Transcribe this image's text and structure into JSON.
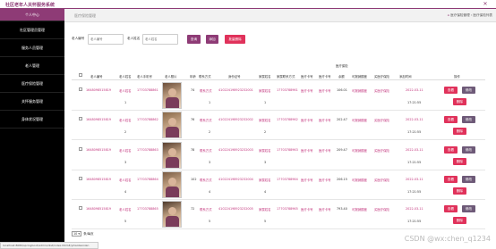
{
  "app": {
    "title": "社区老年人关怀服务系统"
  },
  "sidebar": {
    "items": [
      {
        "label": "个人中心"
      },
      {
        "label": "社区管理员管理"
      },
      {
        "label": "服务人员管理"
      },
      {
        "label": "老人管理"
      },
      {
        "label": "医疗保险管理"
      },
      {
        "label": "关怀服务管理"
      },
      {
        "label": "身体状况管理"
      }
    ]
  },
  "breadcrumb": {
    "tab": "医疗保险管理",
    "home": "⌂",
    "path": "医疗保险管理 › 医疗保险列表"
  },
  "search": {
    "field1_label": "老人编号",
    "field1_placeholder": "老人编号",
    "field2_label": "老人姓名",
    "field2_placeholder": "老人姓名",
    "query_button": "查询",
    "add_button": "添加",
    "batch_delete_button": "批量删除"
  },
  "table": {
    "group_header": "医疗保险",
    "headers": [
      "老人编号",
      "老人姓名",
      "老人手机号",
      "老人照片",
      "年龄",
      "联系方式",
      "身份证号",
      "家属姓名",
      "家属联系方式",
      "医疗卡号",
      "医疗卡号",
      "余额",
      "可报销额度",
      "买医疗保险",
      "添加时间",
      "操作"
    ],
    "rows": [
      {
        "id": "1648098515819",
        "name": "老人姓名",
        "phone": "17703788861",
        "age": "74",
        "contact": "联系方式",
        "idcard": "410224198923232001",
        "family": "家属姓名",
        "family_phone": "17703788961",
        "card": "医疗卡号",
        "card2": "医疗卡号",
        "balance": "106.01",
        "limit": "可报销额度",
        "insurance": "买医疗保险",
        "date": "2022-03-11",
        "time": "17:21:55",
        "extra_a": "1",
        "extra_b": "1",
        "extra_c": "1"
      },
      {
        "id": "1648098515819",
        "name": "老人姓名",
        "phone": "17703788862",
        "age": "76",
        "contact": "联系方式",
        "idcard": "410224198923232002",
        "family": "家属姓名",
        "family_phone": "17703788962",
        "card": "医疗卡号",
        "card2": "医疗卡号",
        "balance": "202.47",
        "limit": "可报销额度",
        "insurance": "买医疗保险",
        "date": "2022-03-11",
        "time": "17:21:55",
        "extra_a": "2",
        "extra_b": "2",
        "extra_c": "2"
      },
      {
        "id": "1648098515819",
        "name": "老人姓名",
        "phone": "17703788863",
        "age": "78",
        "contact": "联系方式",
        "idcard": "410224198923232003",
        "family": "家属姓名",
        "family_phone": "17703788963",
        "card": "医疗卡号",
        "card2": "医疗卡号",
        "balance": "209.47",
        "limit": "可报销额度",
        "insurance": "买医疗保险",
        "date": "2022-03-11",
        "time": "17:21:55",
        "extra_a": "3",
        "extra_b": "3",
        "extra_c": "3"
      },
      {
        "id": "1648098515819",
        "name": "老人姓名",
        "phone": "17703788864",
        "age": "102",
        "contact": "联系方式",
        "idcard": "410224198923232004",
        "family": "家属姓名",
        "family_phone": "17703788964",
        "card": "医疗卡号",
        "card2": "医疗卡号",
        "balance": "206.15",
        "limit": "可报销额度",
        "insurance": "买医疗保险",
        "date": "2022-03-11",
        "time": "17:21:55",
        "extra_a": "4",
        "extra_b": "4",
        "extra_c": "4"
      },
      {
        "id": "1648098515819",
        "name": "老人姓名",
        "phone": "17703788865",
        "age": "72",
        "contact": "联系方式",
        "idcard": "410224198923232005",
        "family": "家属姓名",
        "family_phone": "17703788965",
        "card": "医疗卡号",
        "card2": "医疗卡号",
        "balance": "793.40",
        "limit": "可报销额度",
        "insurance": "买医疗保险",
        "date": "2022-03-11",
        "time": "17:21:55",
        "extra_a": "5",
        "extra_b": "5",
        "extra_c": "5"
      }
    ],
    "row_actions": {
      "view": "查看",
      "edit": "修改",
      "delete": "删除"
    }
  },
  "pagination": {
    "page_size": "10",
    "suffix": "条/每页"
  },
  "statusbar": {
    "text": "localhost:8080/springboot/admin/dist/index.html#/yiliaobaoxian"
  },
  "watermark": "CSDN @wx:chen_q1234",
  "colors": {
    "accent": "#8e3b76",
    "danger": "#e0325b",
    "sidebar_bg": "#000000"
  }
}
